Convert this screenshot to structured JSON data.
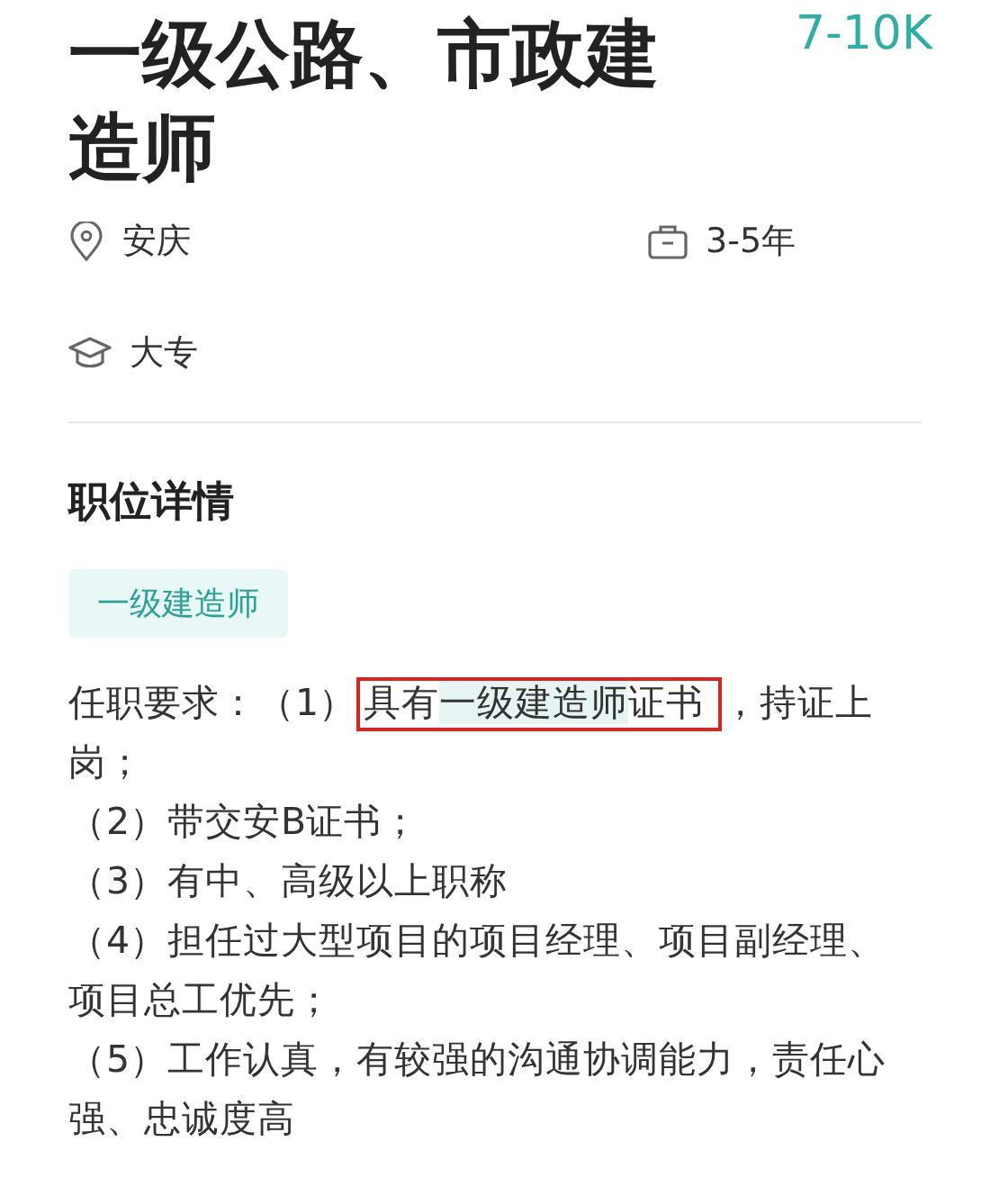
{
  "job": {
    "title": "一级公路、市政建造师",
    "salary": "7-10K"
  },
  "meta": [
    {
      "kind": "location",
      "text": "安庆"
    },
    {
      "kind": "experience",
      "text": "3-5年"
    },
    {
      "kind": "education",
      "text": "大专"
    }
  ],
  "details": {
    "heading": "职位详情",
    "tags": [
      "一级建造师"
    ],
    "first": {
      "prefix": "任职要求：（1）",
      "boxed_before": "具有",
      "highlight": "一级建造师",
      "boxed_after": "证书",
      "rest": "，持证上",
      "continued": "岗；"
    },
    "paragraphs": [
      "（2）带交安B证书；",
      "（3）有中、高级以上职称",
      "（4）担任过大型项目的项目经理、项目副经理、项目总工优先；",
      "（5）工作认真，有较强的沟通协调能力，责任心强、忠诚度高"
    ]
  }
}
